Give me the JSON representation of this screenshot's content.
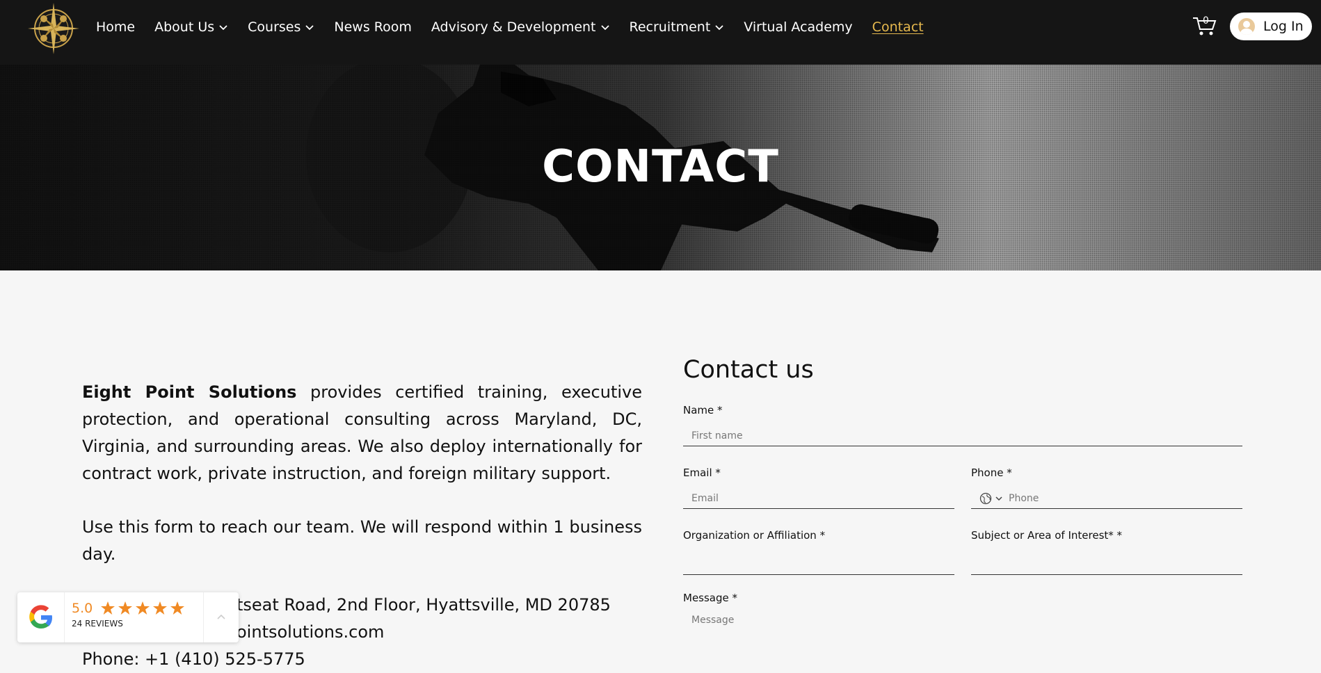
{
  "header": {
    "logo_icon": "compass-rose-logo",
    "nav": [
      {
        "label": "Home",
        "has_dropdown": false
      },
      {
        "label": "About Us",
        "has_dropdown": true
      },
      {
        "label": "Courses",
        "has_dropdown": true
      },
      {
        "label": "News Room",
        "has_dropdown": false
      },
      {
        "label": "Advisory & Development",
        "has_dropdown": true
      },
      {
        "label": "Recruitment",
        "has_dropdown": true
      },
      {
        "label": "Virtual Academy",
        "has_dropdown": false
      },
      {
        "label": "Contact",
        "has_dropdown": false,
        "active": true
      }
    ],
    "cart_count": "0",
    "login_label": "Log In",
    "active_color": "#e6b94e"
  },
  "hero": {
    "title": "CONTACT"
  },
  "about": {
    "company": "Eight Point Solutions",
    "intro_rest": " provides certified training, executive protection, and operational consulting across Maryland, DC, Virginia, and surrounding areas. We also deploy internationally for contract work, private instruction, and foreign military support.",
    "second": "Use this form to reach our team. We will respond within 1 business day.",
    "address": "Address: 5824 Kenilworth Avenue, Riverdale… Hatseat Road, 2nd Floor, Hyattsville, MD 20785",
    "address_visible": "tseat Road, 2nd Floor, Hyattsville, MD 20785",
    "email_visible": "ointsolutions.com",
    "phone_visible": "Phone: +1 (410) 525-5775"
  },
  "form": {
    "title": "Contact us",
    "name_label": "Name *",
    "name_placeholder": "First name",
    "email_label": "Email *",
    "email_placeholder": "Email",
    "phone_label": "Phone *",
    "phone_placeholder": "Phone",
    "org_label": "Organization or Affiliation  *",
    "subject_label": "Subject or Area of Interest* *",
    "message_label": "Message *",
    "message_placeholder": "Message"
  },
  "review_widget": {
    "score": "5.0",
    "reviews": "24 REVIEWS",
    "star_color": "#f08a24"
  }
}
